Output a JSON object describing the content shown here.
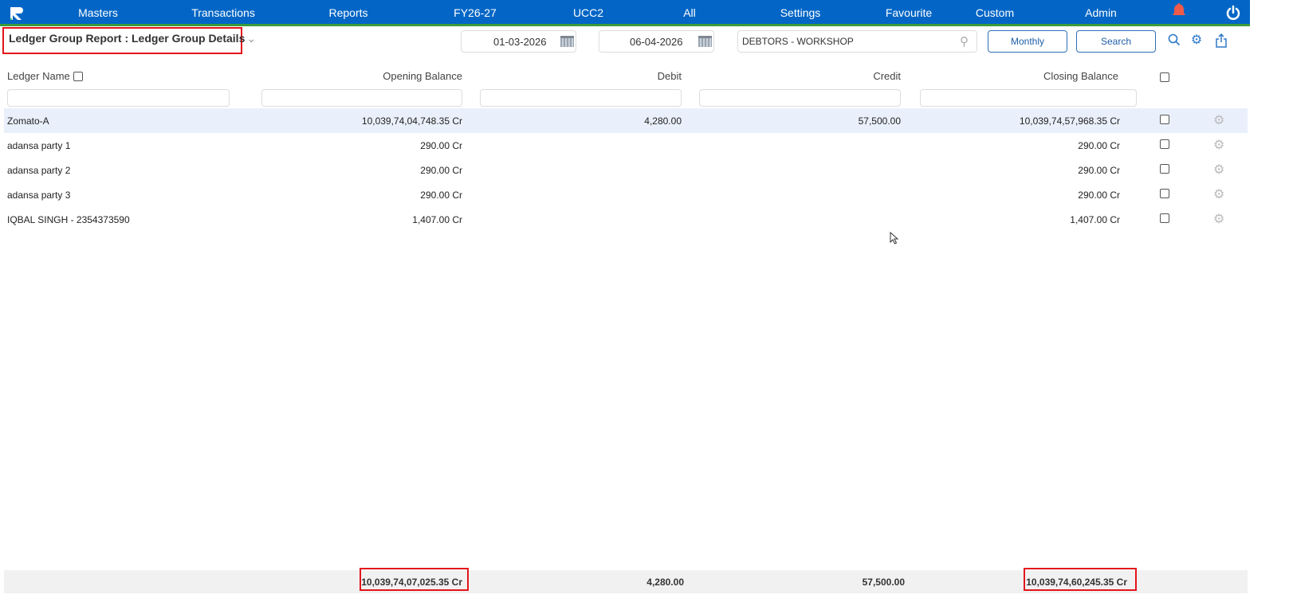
{
  "nav": {
    "items": [
      "Masters",
      "Transactions",
      "Reports",
      "FY26-27",
      "UCC2",
      "All",
      "Settings",
      "Favourite",
      "Custom",
      "Admin"
    ]
  },
  "page": {
    "title": "Ledger Group Report : Ledger Group Details"
  },
  "filters": {
    "from_date": "01-03-2026",
    "to_date": "06-04-2026",
    "group": "DEBTORS - WORKSHOP",
    "monthly_label": "Monthly",
    "search_label": "Search"
  },
  "table": {
    "headers": {
      "name": "Ledger Name",
      "opening": "Opening Balance",
      "debit": "Debit",
      "credit": "Credit",
      "closing": "Closing Balance"
    },
    "rows": [
      {
        "name": "Zomato-A",
        "opening": "10,039,74,04,748.35 Cr",
        "debit": "4,280.00",
        "credit": "57,500.00",
        "closing": "10,039,74,57,968.35 Cr"
      },
      {
        "name": "adansa party 1",
        "opening": "290.00 Cr",
        "debit": "",
        "credit": "",
        "closing": "290.00 Cr"
      },
      {
        "name": "adansa party 2",
        "opening": "290.00 Cr",
        "debit": "",
        "credit": "",
        "closing": "290.00 Cr"
      },
      {
        "name": "adansa party 3",
        "opening": "290.00 Cr",
        "debit": "",
        "credit": "",
        "closing": "290.00 Cr"
      },
      {
        "name": "IQBAL SINGH - 2354373590",
        "opening": "1,407.00 Cr",
        "debit": "",
        "credit": "",
        "closing": "1,407.00 Cr"
      }
    ],
    "totals": {
      "opening": "10,039,74,07,025.35 Cr",
      "debit": "4,280.00",
      "credit": "57,500.00",
      "closing": "10,039,74,60,245.35 Cr"
    }
  },
  "colors": {
    "nav": "#0366c6",
    "accent_green": "#3a9a3a",
    "highlight": "#e3141b",
    "selected_row": "#eaf0fb"
  }
}
